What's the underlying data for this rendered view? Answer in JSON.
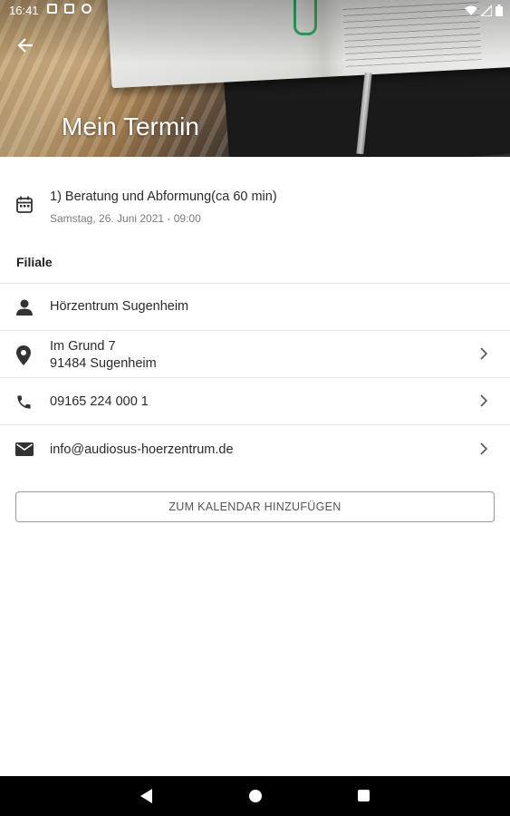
{
  "status_bar": {
    "time": "16:41",
    "notification_icons": [
      "message-icon",
      "clipboard-icon",
      "sync-icon"
    ],
    "system_icons": [
      "wifi-icon",
      "signal-icon",
      "battery-icon"
    ]
  },
  "header": {
    "title": "Mein Termin",
    "back_icon": "arrow-left-icon"
  },
  "appointment": {
    "icon": "calendar-icon",
    "title": "1) Beratung und Abformung(ca 60 min)",
    "date": "Samstag, 26. Juni 2021 - 09:00"
  },
  "branch": {
    "section_label": "Filiale",
    "name": "Hörzentrum Sugenheim",
    "address_line1": "Im Grund 7",
    "address_line2": "91484 Sugenheim",
    "phone": "09165 224 000 1",
    "email": "info@audiosus-hoerzentrum.de"
  },
  "actions": {
    "add_to_calendar_label": "ZUM KALENDAR HINZUFÜGEN"
  },
  "nav_bar": {
    "icons": [
      "nav-back-icon",
      "nav-home-icon",
      "nav-recents-icon"
    ]
  },
  "colors": {
    "primary_text": "#2a2a2a",
    "secondary_text": "#7a7a7a",
    "divider": "#e6e6e6",
    "icon": "#333333"
  }
}
